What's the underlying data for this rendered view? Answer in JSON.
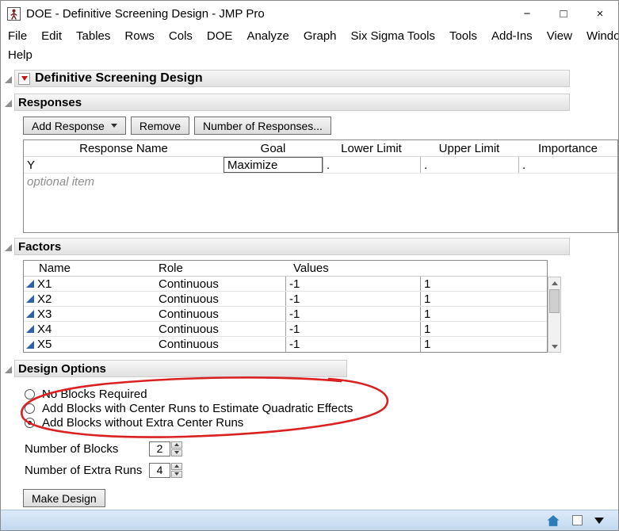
{
  "window": {
    "title": "DOE - Definitive Screening Design - JMP Pro",
    "controls": {
      "minimize": "−",
      "maximize": "□",
      "close": "×"
    }
  },
  "menu": {
    "items": [
      "File",
      "Edit",
      "Tables",
      "Rows",
      "Cols",
      "DOE",
      "Analyze",
      "Graph",
      "Six Sigma Tools",
      "Tools",
      "Add-Ins",
      "View",
      "Window",
      "Help"
    ]
  },
  "outline": {
    "title": "Definitive Screening Design"
  },
  "responses": {
    "title": "Responses",
    "add_response_label": "Add Response",
    "remove_label": "Remove",
    "number_of_responses_label": "Number of Responses...",
    "headers": [
      "Response Name",
      "Goal",
      "Lower Limit",
      "Upper Limit",
      "Importance"
    ],
    "row": {
      "name": "Y",
      "goal": "Maximize",
      "lower": ".",
      "upper": ".",
      "importance": "."
    },
    "optional_item": "optional item"
  },
  "factors": {
    "title": "Factors",
    "headers": [
      "Name",
      "Role",
      "Values"
    ],
    "rows": [
      {
        "name": "X1",
        "role": "Continuous",
        "v1": "-1",
        "v2": "1"
      },
      {
        "name": "X2",
        "role": "Continuous",
        "v1": "-1",
        "v2": "1"
      },
      {
        "name": "X3",
        "role": "Continuous",
        "v1": "-1",
        "v2": "1"
      },
      {
        "name": "X4",
        "role": "Continuous",
        "v1": "-1",
        "v2": "1"
      },
      {
        "name": "X5",
        "role": "Continuous",
        "v1": "-1",
        "v2": "1"
      }
    ]
  },
  "design_options": {
    "title": "Design Options",
    "radios": [
      {
        "label": "No Blocks Required",
        "selected": false
      },
      {
        "label": "Add Blocks with Center Runs to Estimate Quadratic Effects",
        "selected": false
      },
      {
        "label": "Add Blocks without Extra Center Runs",
        "selected": true
      }
    ],
    "number_of_blocks": {
      "label": "Number of Blocks",
      "value": "2"
    },
    "number_of_extra_runs": {
      "label": "Number of Extra Runs",
      "value": "4"
    },
    "make_design_label": "Make Design"
  },
  "annotation": {
    "color": "#d92121"
  }
}
